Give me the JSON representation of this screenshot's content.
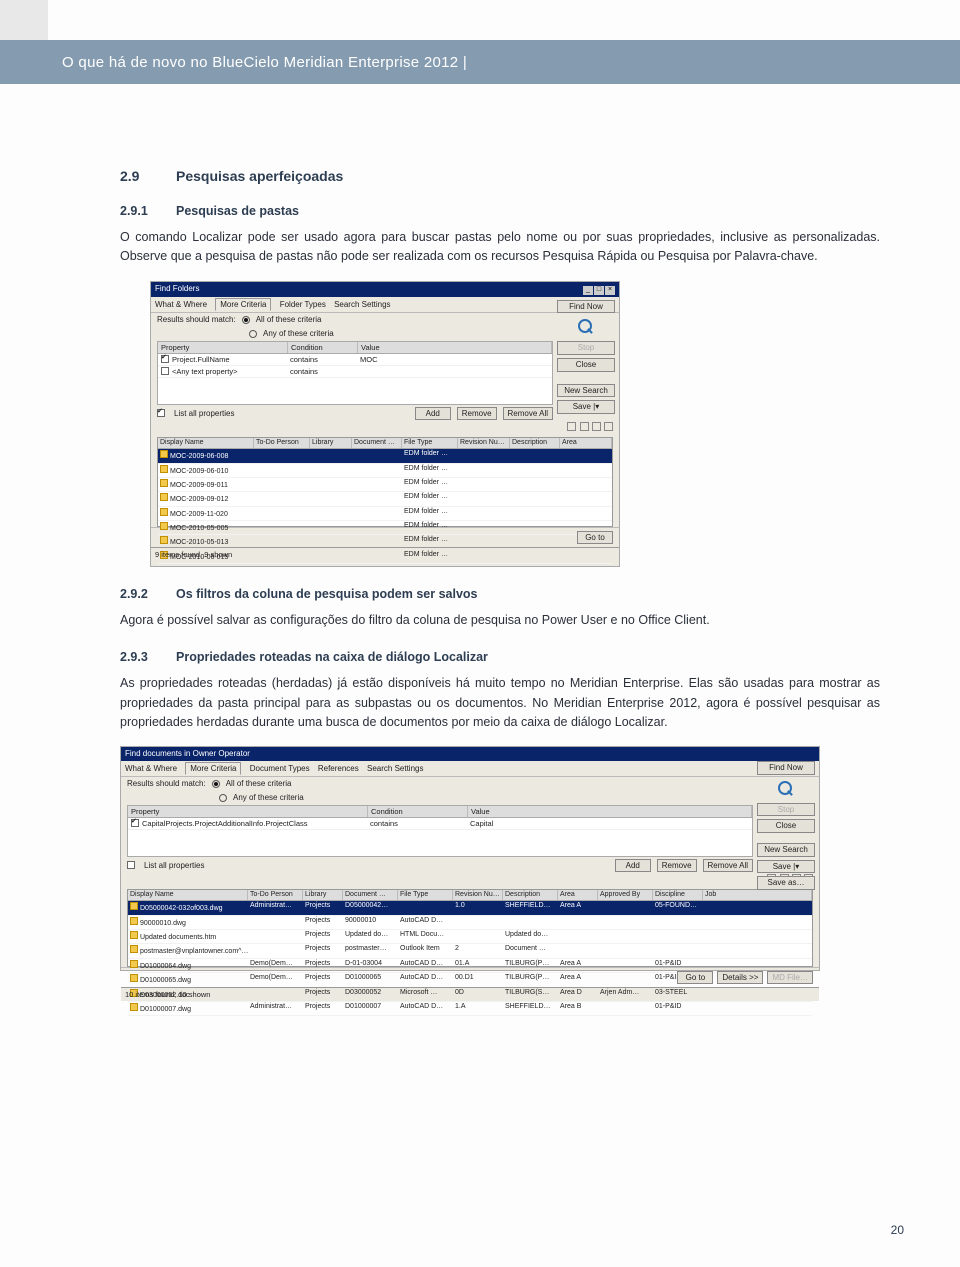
{
  "header": {
    "title": "O que há de novo no BlueCielo Meridian Enterprise 2012  |"
  },
  "section": {
    "num": "2.9",
    "title": "Pesquisas aperfeiçoadas"
  },
  "sub1": {
    "num": "2.9.1",
    "title": "Pesquisas de pastas",
    "para": "O comando Localizar pode ser usado agora para buscar pastas pelo nome ou por suas propriedades, inclusive as personalizadas. Observe que a pesquisa de pastas não pode ser realizada com os recursos Pesquisa Rápida ou Pesquisa por Palavra-chave."
  },
  "sub2": {
    "num": "2.9.2",
    "title": "Os filtros da coluna de pesquisa podem ser salvos",
    "para": "Agora é possível salvar as configurações do filtro da coluna de pesquisa no Power User e no Office Client."
  },
  "sub3": {
    "num": "2.9.3",
    "title": "Propriedades roteadas na caixa de diálogo Localizar",
    "para": "As propriedades roteadas (herdadas) já estão disponíveis há muito tempo no Meridian Enterprise. Elas são usadas para mostrar as propriedades da pasta principal para as subpastas ou os documentos. No Meridian Enterprise 2012, agora é possível pesquisar as propriedades herdadas durante uma busca de documentos por meio da caixa de diálogo Localizar."
  },
  "page_number": "20",
  "shot1": {
    "title": "Find Folders",
    "tabs": [
      "What & Where",
      "More Criteria",
      "Folder Types",
      "Search Settings"
    ],
    "active_tab": "More Criteria",
    "match_label": "Results should match:",
    "match_all": "All of these criteria",
    "match_any": "Any of these criteria",
    "crit_cols": [
      "Property",
      "Condition",
      "Value"
    ],
    "crit_rows": [
      {
        "chk": true,
        "prop": "Project.FullName",
        "cond": "contains",
        "val": "MOC"
      },
      {
        "chk": false,
        "prop": "<Any text property>",
        "cond": "contains",
        "val": ""
      }
    ],
    "list_all": "List all properties",
    "btn_add": "Add",
    "btn_remove": "Remove",
    "btn_remove_all": "Remove All",
    "btn_find": "Find Now",
    "btn_stop": "Stop",
    "btn_close": "Close",
    "btn_newsearch": "New Search",
    "btn_save": "Save  |▾",
    "res_cols": [
      "Display Name",
      "To-Do Person",
      "Library",
      "Document …",
      "File Type",
      "Revision Nu…",
      "Description",
      "Area"
    ],
    "res_rows": [
      "MOC-2009-06-008",
      "MOC-2009-06-010",
      "MOC-2009-09-011",
      "MOC-2009-09-012",
      "MOC-2009-11-020",
      "MOC-2010-05-005",
      "MOC-2010-05-013",
      "MOC-2010-06-015"
    ],
    "file_type": "EDM folder …",
    "btn_goto": "Go to",
    "status": "9 items found, 9 shown"
  },
  "shot2": {
    "title": "Find documents in Owner Operator",
    "tabs": [
      "What & Where",
      "More Criteria",
      "Document Types",
      "References",
      "Search Settings"
    ],
    "active_tab": "More Criteria",
    "match_label": "Results should match:",
    "match_all": "All of these criteria",
    "match_any": "Any of these criteria",
    "crit_cols": [
      "Property",
      "Condition",
      "Value"
    ],
    "crit_rows": [
      {
        "chk": true,
        "prop": "CapitalProjects.ProjectAdditionalInfo.ProjectClass",
        "cond": "contains",
        "val": "Capital"
      }
    ],
    "list_all": "List all properties",
    "btn_add": "Add",
    "btn_remove": "Remove",
    "btn_remove_all": "Remove All",
    "btn_find": "Find Now",
    "btn_stop": "Stop",
    "btn_close": "Close",
    "btn_newsearch": "New Search",
    "btn_save": "Save  |▾",
    "btn_saveas": "Save as…",
    "res_cols": [
      "Display Name",
      "To-Do Person",
      "Library",
      "Document …",
      "File Type",
      "Revision Nu…",
      "Description",
      "Area",
      "Approved By",
      "Discipline",
      "Job"
    ],
    "res_rows": [
      {
        "sel": true,
        "name": "D05000042-032of003.dwg",
        "todo": "Administrat…",
        "lib": "Projects",
        "doc": "D05000042…",
        "ft": "",
        "rev": "1.0",
        "desc": "SHEFFIELD…",
        "area": "Area A",
        "appr": "",
        "disc": "05-FOUND…",
        "job": ""
      },
      {
        "name": "90000010.dwg",
        "todo": "",
        "lib": "Projects",
        "doc": "90000010",
        "ft": "AutoCAD D…",
        "rev": "",
        "desc": "",
        "area": "",
        "appr": "",
        "disc": "",
        "job": ""
      },
      {
        "name": "Updated documents.htm",
        "todo": "",
        "lib": "Projects",
        "doc": "Updated do…",
        "ft": "HTML Docu…",
        "rev": "",
        "desc": "Updated do…",
        "area": "",
        "appr": "",
        "disc": "",
        "job": ""
      },
      {
        "name": "postmaster@vnplantowner.com^…",
        "todo": "",
        "lib": "Projects",
        "doc": "postmaster…",
        "ft": "Outlook Item",
        "rev": "2",
        "desc": "Document …",
        "area": "",
        "appr": "",
        "disc": "",
        "job": ""
      },
      {
        "name": "D01000064.dwg",
        "todo": "Demo(Dem…",
        "lib": "Projects",
        "doc": "D-01-03004",
        "ft": "AutoCAD D…",
        "rev": "01.A",
        "desc": "TILBURG(P…",
        "area": "Area A",
        "appr": "",
        "disc": "01-P&ID",
        "job": ""
      },
      {
        "name": "D01000065.dwg",
        "todo": "Demo(Dem…",
        "lib": "Projects",
        "doc": "D01000065",
        "ft": "AutoCAD D…",
        "rev": "00.D1",
        "desc": "TILBURG(P…",
        "area": "Area A",
        "appr": "",
        "disc": "01-P&ID",
        "job": ""
      },
      {
        "name": "D03000052.doc",
        "todo": "",
        "lib": "Projects",
        "doc": "D03000052",
        "ft": "Microsoft …",
        "rev": "0D",
        "desc": "TILBURG(S…",
        "area": "Area D",
        "appr": "Arjen Adm…",
        "disc": "03-STEEL",
        "job": ""
      },
      {
        "name": "D01000007.dwg",
        "todo": "Administrat…",
        "lib": "Projects",
        "doc": "D01000007",
        "ft": "AutoCAD D…",
        "rev": "1.A",
        "desc": "SHEFFIELD…",
        "area": "Area B",
        "appr": "",
        "disc": "01-P&ID",
        "job": ""
      }
    ],
    "btn_goto": "Go to",
    "btn_details": "Details >>",
    "btn_file": "MD File…",
    "status": "10 items found, 10 shown"
  }
}
